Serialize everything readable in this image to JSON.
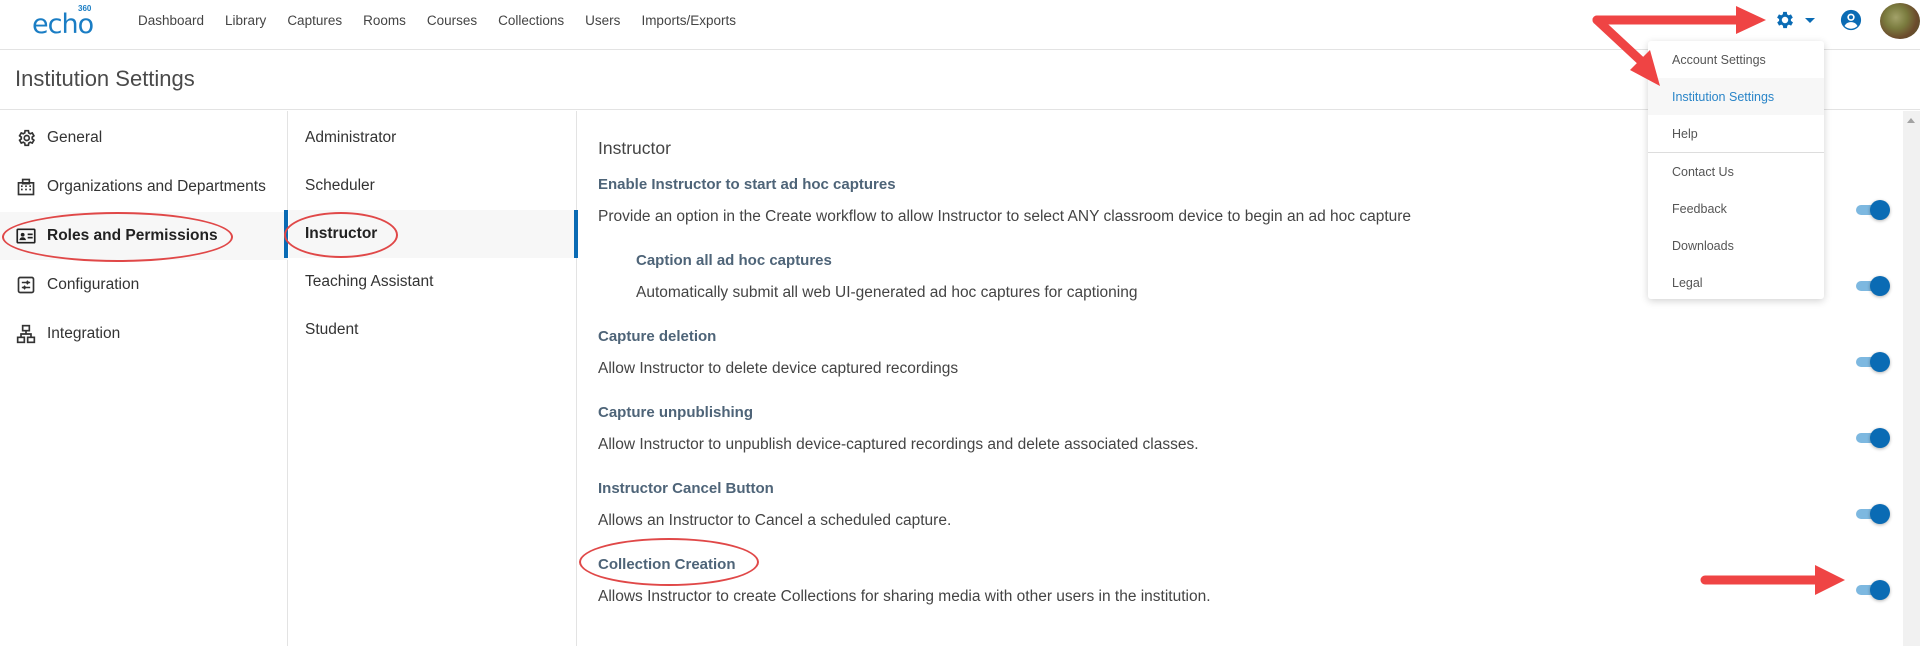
{
  "app": {
    "logo_text": "echo",
    "logo_superscript": "360"
  },
  "top_nav": {
    "items": [
      "Dashboard",
      "Library",
      "Captures",
      "Rooms",
      "Courses",
      "Collections",
      "Users",
      "Imports/Exports"
    ]
  },
  "header_icons": {
    "settings": "gear-icon",
    "settings_caret": "caret-down-icon",
    "user": "user-circle-icon",
    "avatar": "avatar-photo"
  },
  "settings_menu": {
    "items": [
      {
        "label": "Account Settings",
        "active": false
      },
      {
        "label": "Institution Settings",
        "active": true
      },
      {
        "label": "Help",
        "active": false
      },
      {
        "label": "Contact Us",
        "active": false
      },
      {
        "label": "Feedback",
        "active": false
      },
      {
        "label": "Downloads",
        "active": false
      },
      {
        "label": "Legal",
        "active": false
      }
    ]
  },
  "page": {
    "title": "Institution Settings"
  },
  "sidebar": {
    "items": [
      {
        "label": "General",
        "icon": "gear-outline-icon",
        "active": false
      },
      {
        "label": "Organizations and Departments",
        "icon": "building-icon",
        "active": false
      },
      {
        "label": "Roles and Permissions",
        "icon": "id-card-icon",
        "active": true
      },
      {
        "label": "Configuration",
        "icon": "sliders-icon",
        "active": false
      },
      {
        "label": "Integration",
        "icon": "network-icon",
        "active": false
      }
    ]
  },
  "roles": {
    "items": [
      {
        "label": "Administrator",
        "active": false
      },
      {
        "label": "Scheduler",
        "active": false
      },
      {
        "label": "Instructor",
        "active": true
      },
      {
        "label": "Teaching Assistant",
        "active": false
      },
      {
        "label": "Student",
        "active": false
      }
    ]
  },
  "main": {
    "section_title": "Instructor",
    "settings": [
      {
        "title": "Enable Instructor to start ad hoc captures",
        "description": "Provide an option in the Create workflow to allow Instructor to select ANY classroom device to begin an ad hoc capture",
        "enabled": true,
        "indent": false
      },
      {
        "title": "Caption all ad hoc captures",
        "description": "Automatically submit all web UI-generated ad hoc captures for captioning",
        "enabled": true,
        "indent": true
      },
      {
        "title": "Capture deletion",
        "description": "Allow Instructor to delete device captured recordings",
        "enabled": true,
        "indent": false
      },
      {
        "title": "Capture unpublishing",
        "description": "Allow Instructor to unpublish device-captured recordings and delete associated classes.",
        "enabled": true,
        "indent": false
      },
      {
        "title": "Instructor Cancel Button",
        "description": "Allows an Instructor to Cancel a scheduled capture.",
        "enabled": true,
        "indent": false
      },
      {
        "title": "Collection Creation",
        "description": "Allows Instructor to create Collections for sharing media with other users in the institution.",
        "enabled": true,
        "indent": false
      }
    ]
  },
  "colors": {
    "brand": "#1a7dc4",
    "accent": "#0a6bb4",
    "toggle_track": "#7db8e0",
    "setting_title": "#4e6478",
    "annotation": "#ef4444"
  }
}
